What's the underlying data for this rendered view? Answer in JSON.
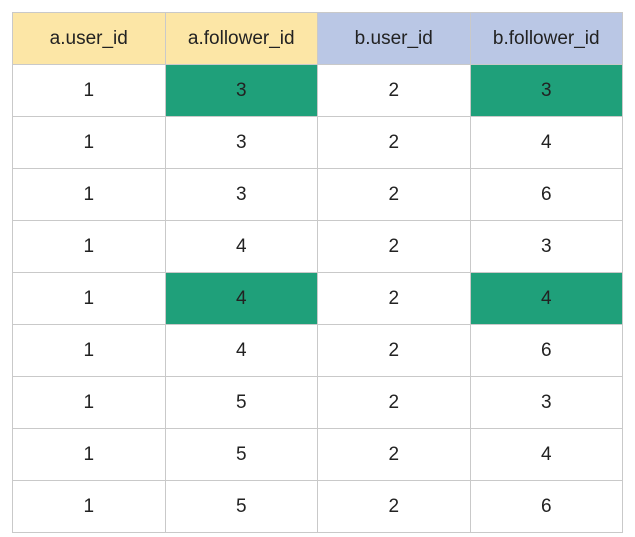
{
  "chart_data": {
    "type": "table",
    "headers": [
      {
        "label": "a.user_id",
        "group": "a"
      },
      {
        "label": "a.follower_id",
        "group": "a"
      },
      {
        "label": "b.user_id",
        "group": "b"
      },
      {
        "label": "b.follower_id",
        "group": "b"
      }
    ],
    "header_colors": {
      "a": "#fce6a6",
      "b": "#bac7e5"
    },
    "highlight_color": "#1fa07a",
    "rows": [
      {
        "cells": [
          {
            "v": 1
          },
          {
            "v": 3,
            "hl": true
          },
          {
            "v": 2
          },
          {
            "v": 3,
            "hl": true
          }
        ]
      },
      {
        "cells": [
          {
            "v": 1
          },
          {
            "v": 3
          },
          {
            "v": 2
          },
          {
            "v": 4
          }
        ]
      },
      {
        "cells": [
          {
            "v": 1
          },
          {
            "v": 3
          },
          {
            "v": 2
          },
          {
            "v": 6
          }
        ]
      },
      {
        "cells": [
          {
            "v": 1
          },
          {
            "v": 4
          },
          {
            "v": 2
          },
          {
            "v": 3
          }
        ]
      },
      {
        "cells": [
          {
            "v": 1
          },
          {
            "v": 4,
            "hl": true
          },
          {
            "v": 2
          },
          {
            "v": 4,
            "hl": true
          }
        ]
      },
      {
        "cells": [
          {
            "v": 1
          },
          {
            "v": 4
          },
          {
            "v": 2
          },
          {
            "v": 6
          }
        ]
      },
      {
        "cells": [
          {
            "v": 1
          },
          {
            "v": 5
          },
          {
            "v": 2
          },
          {
            "v": 3
          }
        ]
      },
      {
        "cells": [
          {
            "v": 1
          },
          {
            "v": 5
          },
          {
            "v": 2
          },
          {
            "v": 4
          }
        ]
      },
      {
        "cells": [
          {
            "v": 1
          },
          {
            "v": 5
          },
          {
            "v": 2
          },
          {
            "v": 6
          }
        ]
      }
    ]
  }
}
